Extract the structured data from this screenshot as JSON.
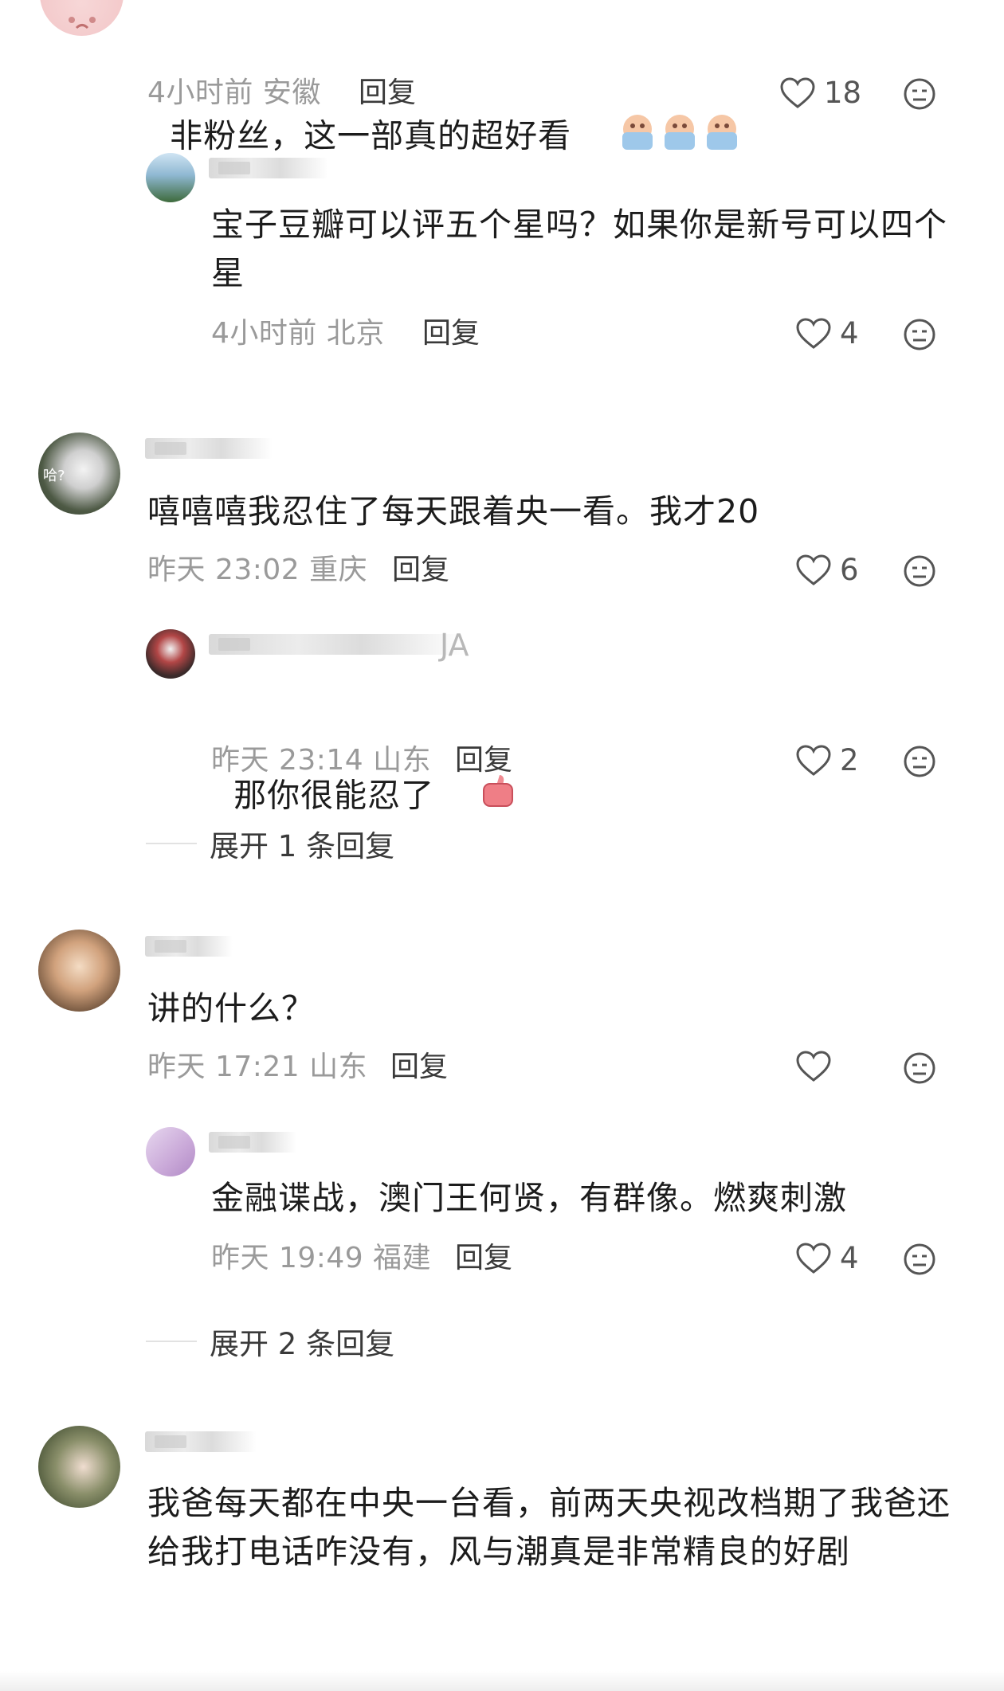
{
  "c1": {
    "text": "非粉丝，这一部真的超好看",
    "time": "4小时前",
    "loc": "安徽",
    "reply": "回复",
    "likes": "18"
  },
  "c1r1": {
    "text": "宝子豆瓣可以评五个星吗？如果你是新号可以四个星",
    "time": "4小时前",
    "loc": "北京",
    "reply": "回复",
    "likes": "4"
  },
  "c2": {
    "text": "嘻嘻嘻我忍住了每天跟着央一看。我才20",
    "time": "昨天 23:02",
    "loc": "重庆",
    "reply": "回复",
    "likes": "6",
    "avatar_text": "哈?"
  },
  "c2r1": {
    "text": "那你很能忍了",
    "name_tail": "JA",
    "time": "昨天 23:14",
    "loc": "山东",
    "reply": "回复",
    "likes": "2"
  },
  "c2_expand": "展开 1 条回复",
  "c3": {
    "text": "讲的什么？",
    "time": "昨天 17:21",
    "loc": "山东",
    "reply": "回复"
  },
  "c3r1": {
    "text": "金融谍战，澳门王何贤，有群像。燃爽刺激",
    "time": "昨天 19:49",
    "loc": "福建",
    "reply": "回复",
    "likes": "4"
  },
  "c3_expand": "展开 2 条回复",
  "c4": {
    "text": "我爸每天都在中央一台看，前两天央视改档期了我爸还给我打电话咋没有，风与潮真是非常精良的好剧"
  },
  "icons": {
    "like": "heart-outline-icon",
    "dislike": "meh-face-icon"
  },
  "colors": {
    "meta": "#9a9a9a",
    "text": "#1c1c1c"
  }
}
